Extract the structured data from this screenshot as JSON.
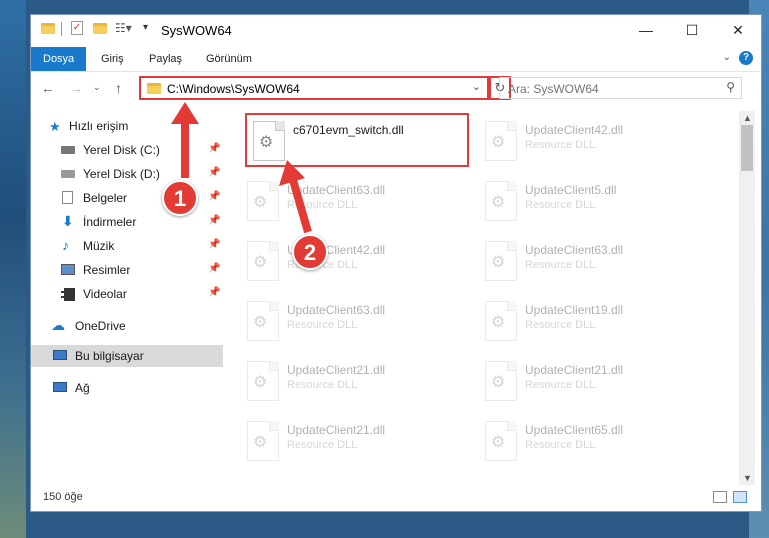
{
  "window": {
    "title": "SysWOW64"
  },
  "ribbon": {
    "tabs": [
      "Dosya",
      "Giriş",
      "Paylaş",
      "Görünüm"
    ]
  },
  "address": {
    "path": "C:\\Windows\\SysWOW64",
    "search_placeholder": "Ara: SysWOW64"
  },
  "nav": {
    "quick_access": "Hızlı erişim",
    "items": [
      "Yerel Disk (C:)",
      "Yerel Disk (D:)",
      "Belgeler",
      "İndirmeler",
      "Müzik",
      "Resimler",
      "Videolar"
    ],
    "onedrive": "OneDrive",
    "this_pc": "Bu bilgisayar",
    "network": "Ağ"
  },
  "files": {
    "highlighted": {
      "name": "c6701evm_switch.dll"
    },
    "col2": [
      {
        "name": "UpdateClient42.dll",
        "desc": "Resource DLL"
      },
      {
        "name": "UpdateClient5.dll",
        "desc": "Resource DLL"
      },
      {
        "name": "UpdateClient63.dll",
        "desc": "Resource DLL"
      },
      {
        "name": "UpdateClient19.dll",
        "desc": "Resource DLL"
      },
      {
        "name": "UpdateClient21.dll",
        "desc": "Resource DLL"
      },
      {
        "name": "UpdateClient65.dll",
        "desc": "Resource DLL"
      }
    ],
    "col1": [
      {
        "name": "UpdateClient63.dll",
        "desc": "Resource DLL"
      },
      {
        "name": "UpdateClient42.dll",
        "desc": "Resource DLL"
      },
      {
        "name": "UpdateClient63.dll",
        "desc": "Resource DLL"
      },
      {
        "name": "UpdateClient21.dll",
        "desc": "Resource DLL"
      },
      {
        "name": "UpdateClient21.dll",
        "desc": "Resource DLL"
      }
    ]
  },
  "status": {
    "count": "150 öğe"
  },
  "annotations": {
    "badge1": "1",
    "badge2": "2",
    "color": "#e23b36"
  }
}
